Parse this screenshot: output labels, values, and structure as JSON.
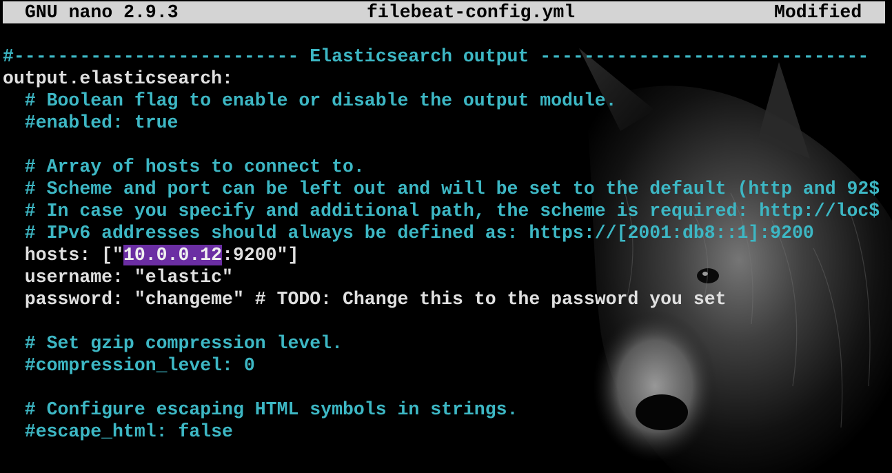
{
  "titlebar": {
    "app": "GNU nano 2.9.3",
    "filename": "filebeat-config.yml",
    "status": "Modified"
  },
  "editor": {
    "lines": [
      {
        "type": "comment",
        "text": "#-------------------------- Elasticsearch output ------------------------------"
      },
      {
        "type": "plain",
        "text": "output.elasticsearch:"
      },
      {
        "type": "comment",
        "text": "  # Boolean flag to enable or disable the output module."
      },
      {
        "type": "comment",
        "text": "  #enabled: true"
      },
      {
        "type": "blank",
        "text": ""
      },
      {
        "type": "comment",
        "text": "  # Array of hosts to connect to."
      },
      {
        "type": "comment",
        "text": "  # Scheme and port can be left out and will be set to the default (http and 92$"
      },
      {
        "type": "comment",
        "text": "  # In case you specify and additional path, the scheme is required: http://loc$"
      },
      {
        "type": "comment",
        "text": "  # IPv6 addresses should always be defined as: https://[2001:db8::1]:9200"
      },
      {
        "type": "hosts",
        "text": ""
      },
      {
        "type": "plain",
        "text": "  username: \"elastic\""
      },
      {
        "type": "plain",
        "text": "  password: \"changeme\" # TODO: Change this to the password you set"
      },
      {
        "type": "blank",
        "text": ""
      },
      {
        "type": "comment",
        "text": "  # Set gzip compression level."
      },
      {
        "type": "comment",
        "text": "  #compression_level: 0"
      },
      {
        "type": "blank",
        "text": ""
      },
      {
        "type": "comment",
        "text": "  # Configure escaping HTML symbols in strings."
      },
      {
        "type": "comment",
        "text": "  #escape_html: false"
      }
    ],
    "hosts_line": {
      "prefix": "  hosts: [\"",
      "selected": "10.0.0.12",
      "suffix": ":9200\"]"
    }
  },
  "background": {
    "image": "wolf-image"
  },
  "colors": {
    "comment": "#3db7c4",
    "plain": "#e0e0e0",
    "selection": "#6b2ea3",
    "titlebar": "#d4d4d4"
  }
}
